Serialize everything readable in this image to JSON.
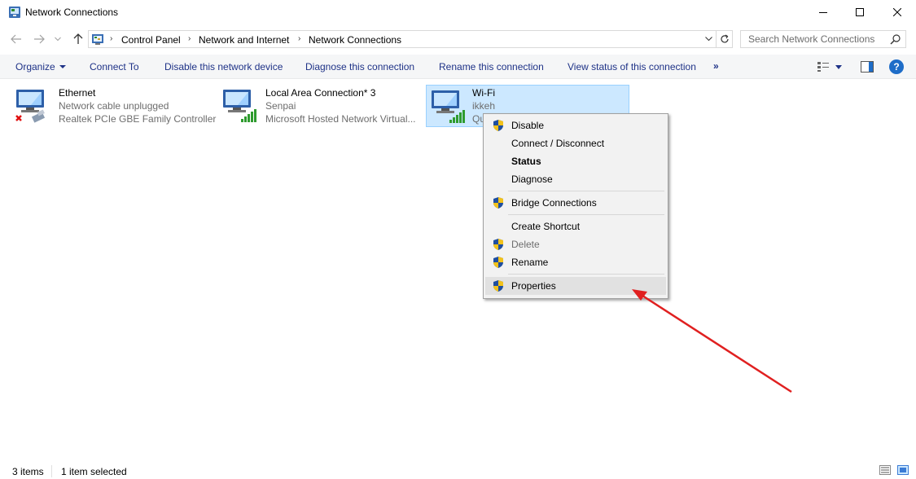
{
  "window": {
    "title": "Network Connections"
  },
  "address": {
    "crumbs": [
      "Control Panel",
      "Network and Internet",
      "Network Connections"
    ]
  },
  "search": {
    "placeholder": "Search Network Connections"
  },
  "commands": {
    "organize": "Organize",
    "connect_to": "Connect To",
    "disable_device": "Disable this network device",
    "diagnose": "Diagnose this connection",
    "rename": "Rename this connection",
    "view_status": "View status of this connection",
    "more": "»",
    "help": "?"
  },
  "items": [
    {
      "name": "Ethernet",
      "status": "Network cable unplugged",
      "device": "Realtek PCIe GBE Family Controller"
    },
    {
      "name": "Local Area Connection* 3",
      "status": "Senpai",
      "device": "Microsoft Hosted Network Virtual..."
    },
    {
      "name": "Wi-Fi",
      "status": "ikkeh",
      "device": "Qu"
    }
  ],
  "context_menu": {
    "items": [
      {
        "label": "Disable",
        "shield": true
      },
      {
        "label": "Connect / Disconnect",
        "shield": false
      },
      {
        "label": "Status",
        "shield": false,
        "bold": true
      },
      {
        "label": "Diagnose",
        "shield": false
      },
      {
        "label": "Bridge Connections",
        "shield": true
      },
      {
        "label": "Create Shortcut",
        "shield": false
      },
      {
        "label": "Delete",
        "shield": true,
        "disabled": true
      },
      {
        "label": "Rename",
        "shield": true
      },
      {
        "label": "Properties",
        "shield": true,
        "highlighted": true
      }
    ]
  },
  "statusbar": {
    "count": "3 items",
    "selected": "1 item selected"
  },
  "colors": {
    "command_text": "#1e3287",
    "selection_bg": "#cce8ff",
    "annotation_arrow": "#e02020"
  }
}
